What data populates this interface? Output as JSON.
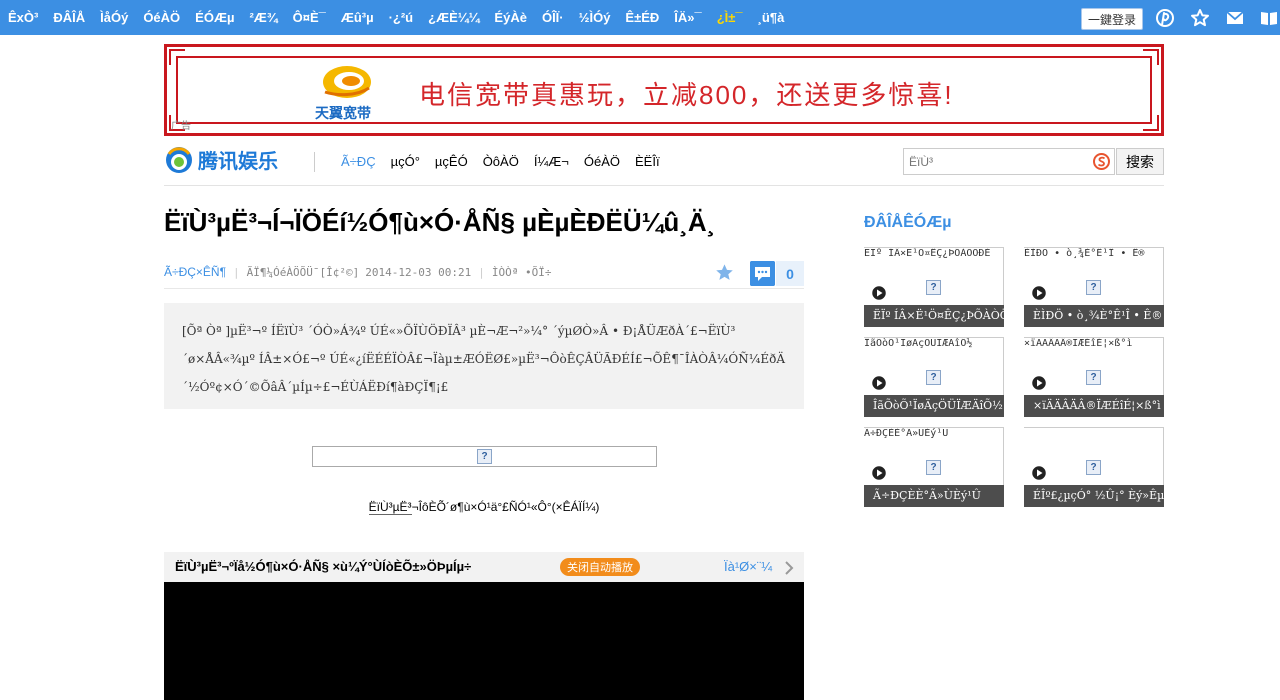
{
  "topbar": {
    "nav": [
      "ÊxÒ³",
      "ĐÂÎÅ",
      "ÌåÓý",
      "ÓéÀÖ",
      "ÉÓÆµ",
      "²Æ¾",
      "Ô¤È¯",
      "Æû³µ",
      "·¿²ú",
      "¿ÆÈ¼¼",
      "ÉýÀè",
      "ÓÎÏ·",
      "½ÌÓý",
      "Ê±ÉÐ",
      "ÎÄ»¯",
      "¿Ì±¯",
      "¸ü¶à"
    ],
    "highlighted_index": 15,
    "login_label": "一鍵登录",
    "icons": [
      "pinterest-icon",
      "star-icon",
      "mail-icon",
      "book-icon"
    ],
    "bg_color": "#3c8fe3"
  },
  "banner": {
    "brand": "天翼宽带",
    "headline": "电信宽带真惠玩，立减800，还送更多惊喜!",
    "ad_mark": "广告",
    "border_color": "#c9171e",
    "text_color": "#d4262a"
  },
  "channel": {
    "name": "腾讯娱乐",
    "nav": [
      "Ã÷ÐÇ",
      "µçÓ°",
      "µçÊÓ",
      "ÒôÀÖ",
      "Í¼Æ¬",
      "ÓéÀÖ",
      "ÈËÎï"
    ],
    "active_index": 0,
    "search_placeholder": "ËïÙ³",
    "search_button": "搜索"
  },
  "article": {
    "title": "ËïÙ³µË³¬Í¬ÏÖÉí½Ó¶ù×Ó·ÅÑ§ µÈµÈÐËÜ¼û¸Ä¸",
    "source": "Ã÷ÐÇ×ÊÑ¶",
    "meta_text": "ÃÏ¶¼ÓéÀÖÕÜ¯[Î¢²©]",
    "timestamp": "2014-12-03 00:21",
    "meta_extra": "ÌÒÒª •ÕÏ÷",
    "comment_count": "0",
    "summary": [
      "[Õª Òª ]µË³¬º ÍËïÙ³ ´ÓÒ»Á¾º ÚÉ«»ÕÏÙÖÐÏÂ³ µÈ¬Æ¬²»¼°  ´ýµØÒ»Â • Ð¡ÅÜÆðÀ´£¬ËïÙ³",
      "´ø×ÅÂ«¾µº ÍÂ±×Ó£¬º ÚÉ«¿íËÉÉÏÒÂ£¬Ïàµ±ÆÓËØ£»µË³¬ÔòÊÇÂÜÃÐÉÍ£¬ÕÊ¶¯ÎÀÒÂ¼ÓÑ¼ÉðÄ±£¬Â",
      "´½Óº¢×Ó´©ÕâÂ´µÍµ÷£¬ÉÙÁËÐí¶àÐÇÏ¶¡£"
    ],
    "caption": "ËïÙ³µË³¬ÎôÈÕ´ø¶ù×Ó¹ä°£ÑÓ¹«Ô°(×ÊÁÏÍ¼)",
    "caption_underlined": "ËïÙ³µË³"
  },
  "video": {
    "title": "ËïÙ³µË³¬ºÏå½Ó¶ù×Ó·ÅÑ§ ×ù¼Ý°ÙÍòÈÕ±»ÖÞµÍµ÷",
    "autoplay_label": "关闭自动播放",
    "more_label": "Ïà¹Ø×¨¼"
  },
  "sidebar": {
    "title": "ÐÂÎÅÊÓÆµ",
    "cards": [
      {
        "top": "ËÏº ÍÂ×Ë¹Ö¤ÊÇ¿ÞÕÀÒÖÐÈ",
        "caption": "ËÏº ÍÂ×Ë¹Ö¤ÊÇ¿ÞÕÀÒÖÐÈ"
      },
      {
        "top": "ÈÌÐÖ • ò¸¾È°Ê¹Î • Ê®",
        "caption": "ÈÌÐÖ • ò¸¾È°Ê¹Î • Ê®"
      },
      {
        "top": "ÎãÕòÕ¹ÏøÄçÖÜÏÆÄîÕ½",
        "caption": "ÎãÕòÕ¹ÏøÄçÖÜÏÆÄîÕ½"
      },
      {
        "top": "×ïÄÄÂÄÂ®ÏÆÉîÉ¦×ß°ì",
        "caption": "×ïÄÄÂÄÂ®ÏÆÉîÉ¦×ß°ì"
      },
      {
        "top": "Ã÷ÐÇÈÈ°Ã»ÙÈý¹Û",
        "caption": "Ã÷ÐÇÈÈ°Ã»ÙÈý¹Û"
      },
      {
        "top": "",
        "caption": "ÉÎº£¿µçÓ° ½Û¡° Èý»Êµº ¡"
      }
    ]
  }
}
